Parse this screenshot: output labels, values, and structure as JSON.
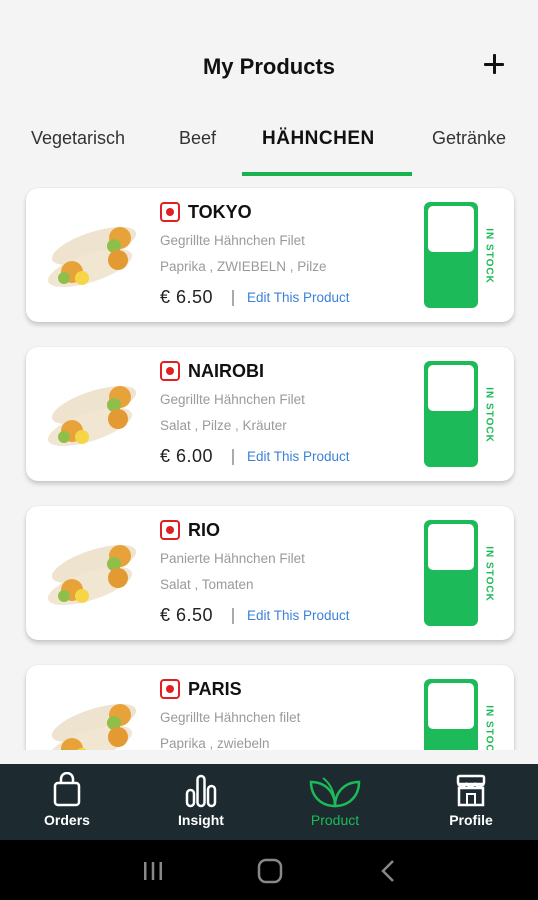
{
  "header": {
    "title": "My Products"
  },
  "tabs": [
    {
      "label": "Vegetarisch",
      "active": false
    },
    {
      "label": "Beef",
      "active": false
    },
    {
      "label": "HÄHNCHEN",
      "active": true
    },
    {
      "label": "Getränke",
      "active": false
    }
  ],
  "products": [
    {
      "name": "TOKYO",
      "description": "Gegrillte Hähnchen Filet",
      "ingredients": "Paprika , ZWIEBELN , Pilze",
      "price": "€ 6.50",
      "edit_label": "Edit This Product",
      "stock_label": "IN STOCK"
    },
    {
      "name": "NAIROBI",
      "description": "Gegrillte Hähnchen Filet",
      "ingredients": "Salat , Pilze , Kräuter",
      "price": "€ 6.00",
      "edit_label": "Edit This Product",
      "stock_label": "IN STOCK"
    },
    {
      "name": "RIO",
      "description": "Panierte Hähnchen Filet",
      "ingredients": "Salat , Tomaten",
      "price": "€ 6.50",
      "edit_label": "Edit This Product",
      "stock_label": "IN STOCK"
    },
    {
      "name": "PARIS",
      "description": "Gegrillte Hähnchen filet",
      "ingredients": "Paprika , zwiebeln",
      "price": "",
      "edit_label": "",
      "stock_label": "IN STOCK"
    }
  ],
  "nav": [
    {
      "label": "Orders",
      "icon": "shopping-bag-icon"
    },
    {
      "label": "Insight",
      "icon": "bar-chart-icon"
    },
    {
      "label": "Product",
      "icon": "leaf-icon",
      "active": true
    },
    {
      "label": "Profile",
      "icon": "store-icon"
    }
  ],
  "colors": {
    "accent": "#1cba58",
    "nav_bg": "#1d2b30",
    "link": "#3b82d8",
    "veg_mark": "#e02020"
  }
}
